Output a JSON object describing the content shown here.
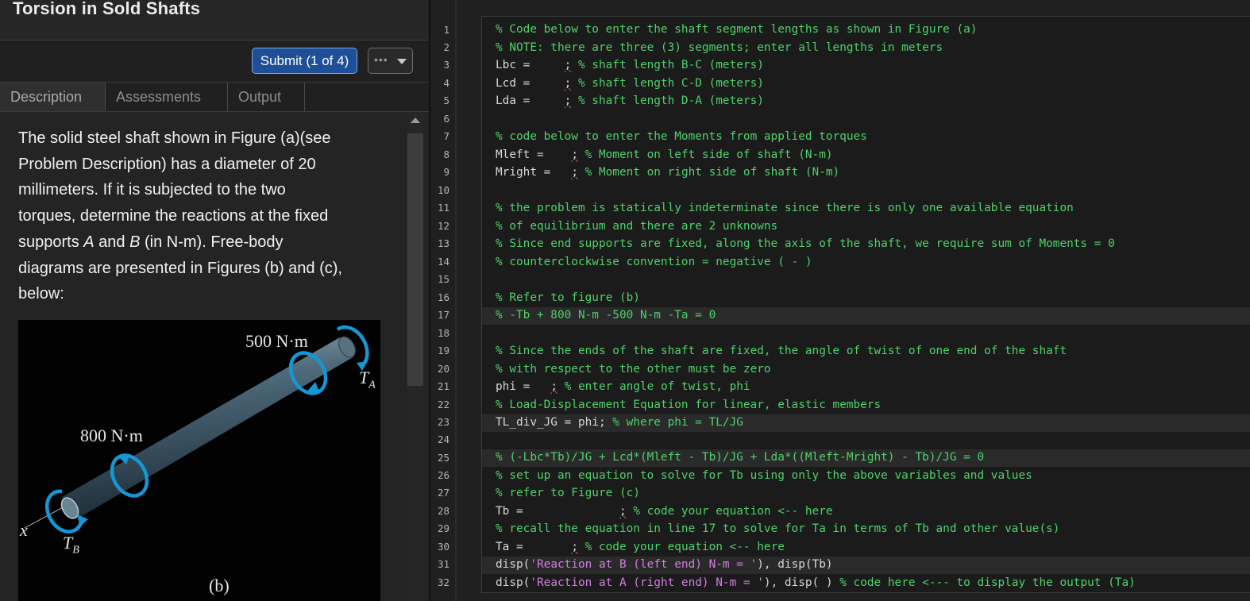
{
  "header": {
    "title": "Torsion in Sold Shafts"
  },
  "toolbar": {
    "submit_label": "Submit (1 of 4)",
    "more_label": "•••"
  },
  "tabs": [
    {
      "label": "Description",
      "active": true
    },
    {
      "label": "Assessments",
      "active": false
    },
    {
      "label": "Output",
      "active": false
    }
  ],
  "description": {
    "lines": [
      "The solid steel shaft shown in Figure (a)(see",
      "Problem Description) has a diameter of 20",
      "millimeters. If it is subjected to the two",
      "torques, determine the reactions at the fixed"
    ],
    "line5_pre": "supports ",
    "line5_a": "A",
    "line5_mid": " and ",
    "line5_b": "B",
    "line5_post": " (in N-m). Free-body",
    "line6": "diagrams are presented in Figures (b) and (c),",
    "line7": "below:"
  },
  "figure": {
    "label_500": "500 N·m",
    "label_800": "800 N·m",
    "label_ta": "T",
    "label_ta_sub": "A",
    "label_tb": "T",
    "label_tb_sub": "B",
    "label_x": "x",
    "caption": "(b)",
    "accent_color": "#1597d5"
  },
  "editor": {
    "line_numbers": [
      "1",
      "2",
      "3",
      "4",
      "5",
      "6",
      "7",
      "8",
      "9",
      "10",
      "11",
      "12",
      "13",
      "14",
      "15",
      "16",
      "17",
      "18",
      "19",
      "20",
      "21",
      "22",
      "23",
      "24",
      "25",
      "26",
      "27",
      "28",
      "29",
      "30",
      "31",
      "32"
    ],
    "lines": {
      "l1": "% Code below to enter the shaft segment lengths as shown in Figure (a)",
      "l2": "% NOTE: there are three (3) segments; enter all lengths in meters",
      "l3a": "Lbc =     ",
      "l3b": ";",
      "l3c": " % shaft length B-C (meters)",
      "l4a": "Lcd =     ",
      "l4b": ";",
      "l4c": " % shaft length C-D (meters)",
      "l5a": "Lda =     ",
      "l5b": ";",
      "l5c": " % shaft length D-A (meters)",
      "l7": "% code below to enter the Moments from applied torques",
      "l8a": "Mleft =    ",
      "l8b": ";",
      "l8c": " % Moment on left side of shaft (N-m)",
      "l9a": "Mright =   ",
      "l9b": ";",
      "l9c": " % Moment on right side of shaft (N-m)",
      "l11": "% the problem is statically indeterminate since there is only one available equation",
      "l12": "% of equilibrium and there are 2 unknowns",
      "l13": "% Since end supports are fixed, along the axis of the shaft, we require sum of Moments = 0",
      "l14": "% counterclockwise convention = negative ( - )",
      "l16": "% Refer to figure (b)",
      "l17": "% -Tb + 800 N-m -500 N-m -Ta = 0",
      "l19": "% Since the ends of the shaft are fixed, the angle of twist of one end of the shaft",
      "l20": "% with respect to the other must be zero",
      "l21a": "phi =   ",
      "l21b": ";",
      "l21c": " % enter angle of twist, phi",
      "l22": "% Load-Displacement Equation for linear, elastic members",
      "l23a": "TL_div_JG = phi;",
      "l23b": " % where phi = TL/JG",
      "l25": "% (-Lbc*Tb)/JG + Lcd*(Mleft - Tb)/JG + Lda*((Mleft-Mright) - Tb)/JG = 0",
      "l26": "% set up an equation to solve for Tb using only the above variables and values",
      "l27": "% refer to Figure (c)",
      "l28a": "Tb =              ",
      "l28b": ";",
      "l28c": " % code your equation <-- here",
      "l29": "% recall the equation in line 17 to solve for Ta in terms of Tb and other value(s)",
      "l30a": "Ta =       ",
      "l30b": ";",
      "l30c": " % code your equation <-- here",
      "l31a": "disp(",
      "l31b": "'Reaction at B (left end) N-m = '",
      "l31c": "), disp(Tb)",
      "l32a": "disp(",
      "l32b": "'Reaction at A (right end) N-m = '",
      "l32c": "), disp( ) ",
      "l32d": "% code here <--- to display the output (Ta)"
    }
  },
  "colors": {
    "comment": "#4fd16a",
    "string": "#d27ee0",
    "submit_bg": "#1f4f97",
    "background": "#1e1e1e"
  }
}
